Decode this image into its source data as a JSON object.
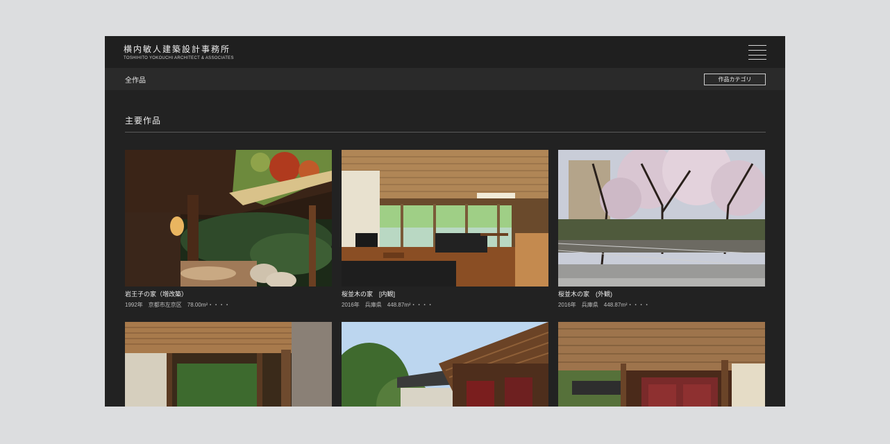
{
  "header": {
    "logo_jp": "横内敏人建築設計事務所",
    "logo_en": "TOSHIHITO YOKOUCHI ARCHITECT & ASSOCIATES",
    "menu_icon": "hamburger-menu-icon"
  },
  "subnav": {
    "breadcrumb": "全作品",
    "category_button": "作品カテゴリ"
  },
  "section": {
    "title": "主要作品"
  },
  "works": [
    {
      "title": "岩王子の家（増改築）",
      "meta": "1992年　京都市左京区　78.00m²・・・・"
    },
    {
      "title": "桜並木の家　[内観]",
      "meta": "2016年　兵庫県　448.87m²・・・・"
    },
    {
      "title": "桜並木の家　(外観)",
      "meta": "2016年　兵庫県　448.87m²・・・・"
    },
    {
      "title": "",
      "meta": ""
    },
    {
      "title": "",
      "meta": ""
    },
    {
      "title": "",
      "meta": ""
    }
  ],
  "colors": {
    "page_bg": "#dcdddf",
    "window_bg": "#222222",
    "topbar_bg": "#1f1f1f",
    "subbar_bg": "#2a2a2a"
  }
}
